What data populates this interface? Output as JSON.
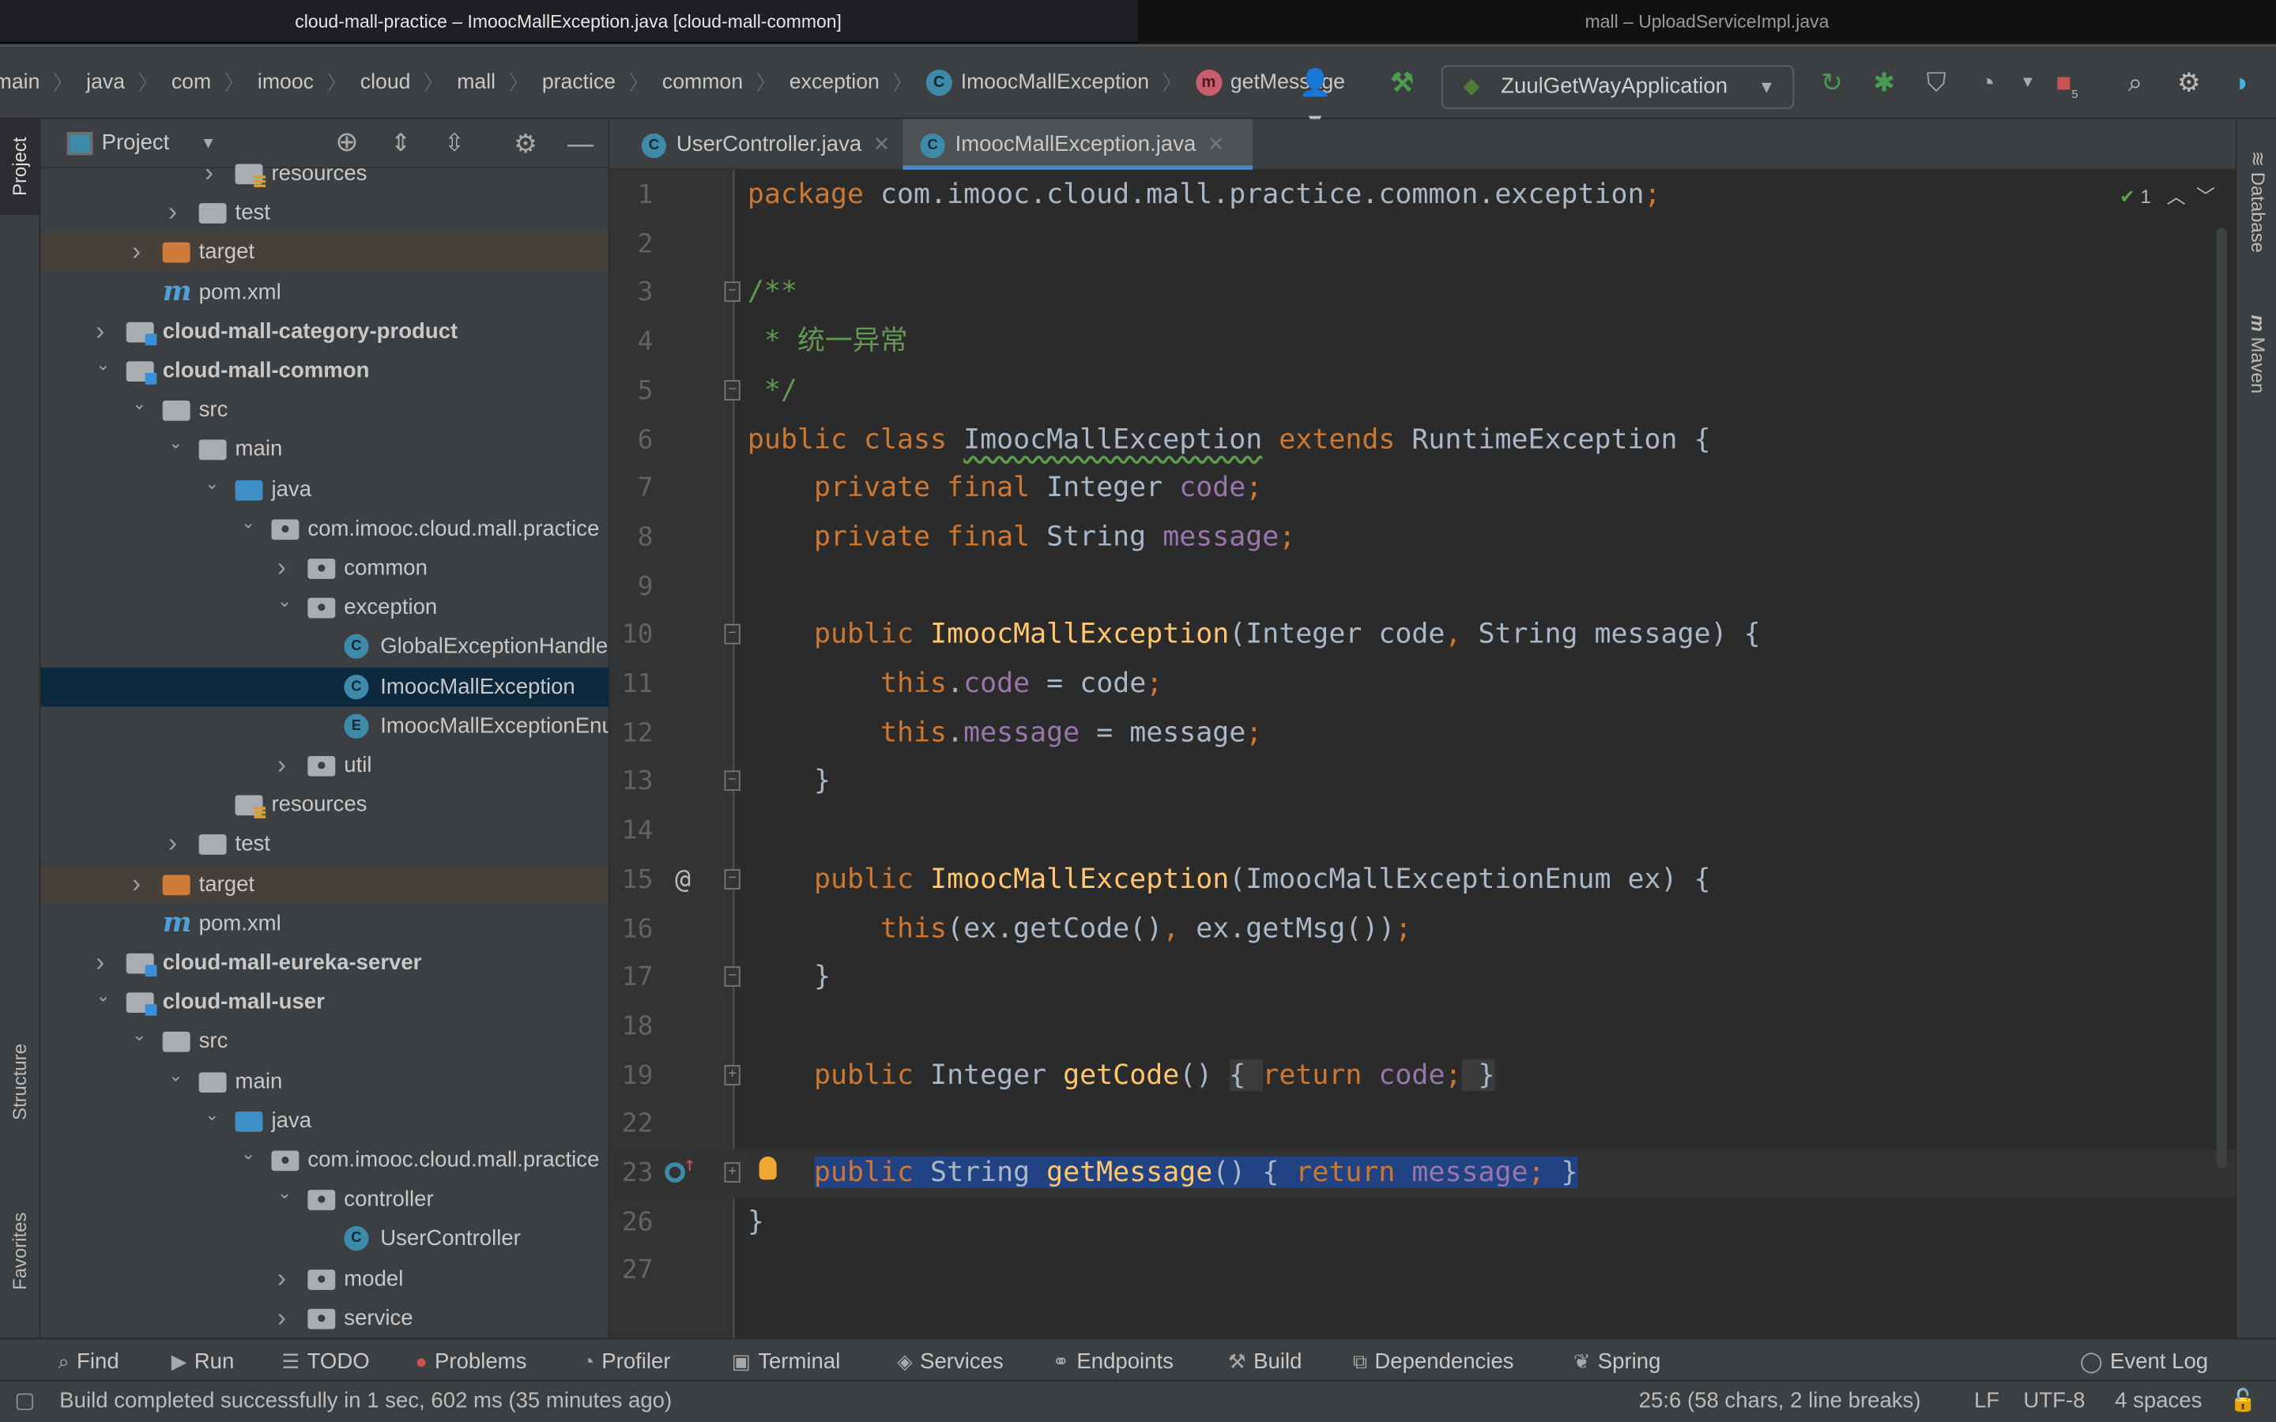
{
  "window": {
    "title": "cloud-mall-practice – ImoocMallException.java [cloud-mall-common]",
    "other_window_title": "mall – UploadServiceImpl.java"
  },
  "breadcrumb": [
    "main",
    "java",
    "com",
    "imooc",
    "cloud",
    "mall",
    "practice",
    "common",
    "exception",
    "ImoocMallException",
    "getMessage"
  ],
  "run_config": {
    "label": "ZuulGetWayApplication"
  },
  "toolbar_icons": [
    "user-icon",
    "hammer-icon",
    "rerun-icon",
    "debug-icon",
    "coverage-icon",
    "profile-icon",
    "stop-icon",
    "search-icon",
    "gear-icon",
    "toolbox-logo-icon"
  ],
  "stop_badge": "5",
  "left_stripe": {
    "project": "Project",
    "structure": "Structure",
    "favorites": "Favorites"
  },
  "right_stripe": {
    "database": "Database",
    "maven": "Maven"
  },
  "project_panel": {
    "title": "Project",
    "tree": [
      {
        "name": "resources",
        "depth": 3,
        "icon": "res",
        "expanded": false
      },
      {
        "name": "test",
        "depth": 2,
        "icon": "folder",
        "expanded": false
      },
      {
        "name": "target",
        "depth": 1,
        "icon": "excl",
        "expanded": false,
        "highlight": true
      },
      {
        "name": "pom.xml",
        "depth": 1,
        "icon": "mvn"
      },
      {
        "name": "cloud-mall-category-product",
        "depth": 0,
        "icon": "module",
        "expanded": false,
        "bold": true
      },
      {
        "name": "cloud-mall-common",
        "depth": 0,
        "icon": "module",
        "expanded": true,
        "bold": true
      },
      {
        "name": "src",
        "depth": 1,
        "icon": "folder",
        "expanded": true
      },
      {
        "name": "main",
        "depth": 2,
        "icon": "folder",
        "expanded": true
      },
      {
        "name": "java",
        "depth": 3,
        "icon": "src",
        "expanded": true
      },
      {
        "name": "com.imooc.cloud.mall.practice",
        "depth": 4,
        "icon": "pkg",
        "expanded": true
      },
      {
        "name": "common",
        "depth": 5,
        "icon": "pkg",
        "expanded": false
      },
      {
        "name": "exception",
        "depth": 5,
        "icon": "pkg",
        "expanded": true
      },
      {
        "name": "GlobalExceptionHandler",
        "depth": 6,
        "icon": "cls"
      },
      {
        "name": "ImoocMallException",
        "depth": 6,
        "icon": "cls",
        "selected": true
      },
      {
        "name": "ImoocMallExceptionEnum",
        "depth": 6,
        "icon": "enm"
      },
      {
        "name": "util",
        "depth": 5,
        "icon": "pkg",
        "expanded": false
      },
      {
        "name": "resources",
        "depth": 3,
        "icon": "res"
      },
      {
        "name": "test",
        "depth": 2,
        "icon": "folder",
        "expanded": false
      },
      {
        "name": "target",
        "depth": 1,
        "icon": "excl",
        "expanded": false,
        "highlight": true
      },
      {
        "name": "pom.xml",
        "depth": 1,
        "icon": "mvn"
      },
      {
        "name": "cloud-mall-eureka-server",
        "depth": 0,
        "icon": "module",
        "expanded": false,
        "bold": true
      },
      {
        "name": "cloud-mall-user",
        "depth": 0,
        "icon": "module",
        "expanded": true,
        "bold": true
      },
      {
        "name": "src",
        "depth": 1,
        "icon": "folder",
        "expanded": true
      },
      {
        "name": "main",
        "depth": 2,
        "icon": "folder",
        "expanded": true
      },
      {
        "name": "java",
        "depth": 3,
        "icon": "src",
        "expanded": true
      },
      {
        "name": "com.imooc.cloud.mall.practice",
        "depth": 4,
        "icon": "pkg",
        "expanded": true
      },
      {
        "name": "controller",
        "depth": 5,
        "icon": "pkg",
        "expanded": true
      },
      {
        "name": "UserController",
        "depth": 6,
        "icon": "cls"
      },
      {
        "name": "model",
        "depth": 5,
        "icon": "pkg",
        "expanded": false
      },
      {
        "name": "service",
        "depth": 5,
        "icon": "pkg",
        "expanded": false
      }
    ]
  },
  "tabs": [
    {
      "label": "UserController.java",
      "active": false
    },
    {
      "label": "ImoocMallException.java",
      "active": true
    }
  ],
  "editor": {
    "inspection_count": "1",
    "lines": [
      {
        "n": "1",
        "t": [
          [
            "package",
            "kw"
          ],
          [
            " com.imooc.cloud.mall.practice.common.exception",
            ""
          ],
          [
            ";",
            "kw"
          ]
        ]
      },
      {
        "n": "2",
        "t": []
      },
      {
        "n": "3",
        "fold": "open",
        "t": [
          [
            "/**",
            "cm"
          ]
        ]
      },
      {
        "n": "4",
        "t": [
          [
            " * 统一异常",
            "cm"
          ]
        ]
      },
      {
        "n": "5",
        "fold": "close",
        "t": [
          [
            " */",
            "cm"
          ]
        ]
      },
      {
        "n": "6",
        "t": [
          [
            "public class ",
            "kw"
          ],
          [
            "ImoocMallException",
            "sq"
          ],
          [
            " ",
            ""
          ],
          [
            "extends ",
            "kw"
          ],
          [
            "RuntimeException {",
            ""
          ]
        ]
      },
      {
        "n": "7",
        "t": [
          [
            "    private final ",
            "kw"
          ],
          [
            "Integer ",
            ""
          ],
          [
            "code",
            "fd"
          ],
          [
            ";",
            "kw"
          ]
        ]
      },
      {
        "n": "8",
        "t": [
          [
            "    private final ",
            "kw"
          ],
          [
            "String ",
            ""
          ],
          [
            "message",
            "fd"
          ],
          [
            ";",
            "kw"
          ]
        ]
      },
      {
        "n": "9",
        "t": []
      },
      {
        "n": "10",
        "fold": "open",
        "t": [
          [
            "    public ",
            "kw"
          ],
          [
            "ImoocMallException",
            "fn"
          ],
          [
            "(Integer code",
            ""
          ],
          [
            ", ",
            "kw"
          ],
          [
            "String message) {",
            ""
          ]
        ]
      },
      {
        "n": "11",
        "t": [
          [
            "        this",
            "kw"
          ],
          [
            ".",
            ""
          ],
          [
            "code",
            "fd"
          ],
          [
            " = code",
            ""
          ],
          [
            ";",
            "kw"
          ]
        ]
      },
      {
        "n": "12",
        "t": [
          [
            "        this",
            "kw"
          ],
          [
            ".",
            ""
          ],
          [
            "message",
            "fd"
          ],
          [
            " = message",
            ""
          ],
          [
            ";",
            "kw"
          ]
        ]
      },
      {
        "n": "13",
        "fold": "close",
        "t": [
          [
            "    }",
            ""
          ]
        ]
      },
      {
        "n": "14",
        "t": []
      },
      {
        "n": "15",
        "fold": "open",
        "at": true,
        "t": [
          [
            "    public ",
            "kw"
          ],
          [
            "ImoocMallException",
            "fn"
          ],
          [
            "(ImoocMallExceptionEnum ex) {",
            ""
          ]
        ]
      },
      {
        "n": "16",
        "t": [
          [
            "        this",
            "kw"
          ],
          [
            "(ex.getCode()",
            ""
          ],
          [
            ", ",
            "kw"
          ],
          [
            "ex.getMsg())",
            ""
          ],
          [
            ";",
            "kw"
          ]
        ]
      },
      {
        "n": "17",
        "fold": "close",
        "t": [
          [
            "    }",
            ""
          ]
        ]
      },
      {
        "n": "18",
        "t": []
      },
      {
        "n": "19",
        "fold": "plus",
        "t": [
          [
            "    public ",
            "kw"
          ],
          [
            "Integer ",
            ""
          ],
          [
            "getCode",
            "fn"
          ],
          [
            "() ",
            ""
          ],
          [
            "{ ",
            "fold"
          ],
          [
            "return ",
            "kw"
          ],
          [
            "code",
            "fd"
          ],
          [
            ";",
            "kw"
          ],
          [
            " }",
            "fold"
          ]
        ]
      },
      {
        "n": "22",
        "t": []
      },
      {
        "n": "23",
        "fold": "plus",
        "current": true,
        "override": true,
        "bulb": true,
        "t": [
          [
            "    ",
            ""
          ],
          [
            "public ",
            "kw sel"
          ],
          [
            "String ",
            "sel"
          ],
          [
            "getMessage",
            "fn sel"
          ],
          [
            "() ",
            "sel"
          ],
          [
            "{ ",
            "sel"
          ],
          [
            "return ",
            "kw sel"
          ],
          [
            "message",
            "fd sel"
          ],
          [
            "; ",
            "kw sel"
          ],
          [
            "}",
            "sel"
          ]
        ]
      },
      {
        "n": "26",
        "t": [
          [
            "}",
            ""
          ]
        ]
      },
      {
        "n": "27",
        "t": []
      }
    ]
  },
  "tool_windows": [
    {
      "label": "Find",
      "icon": "search-icon"
    },
    {
      "label": "Run",
      "icon": "play-icon"
    },
    {
      "label": "TODO",
      "icon": "list-icon"
    },
    {
      "label": "Problems",
      "icon": "error-icon"
    },
    {
      "label": "Profiler",
      "icon": "profiler-icon"
    },
    {
      "label": "Terminal",
      "icon": "terminal-icon"
    },
    {
      "label": "Services",
      "icon": "services-icon"
    },
    {
      "label": "Endpoints",
      "icon": "endpoints-icon"
    },
    {
      "label": "Build",
      "icon": "hammer-icon"
    },
    {
      "label": "Dependencies",
      "icon": "dependencies-icon"
    },
    {
      "label": "Spring",
      "icon": "spring-icon"
    }
  ],
  "event_log": "Event Log",
  "status": {
    "message": "Build completed successfully in 1 sec, 602 ms (35 minutes ago)",
    "position": "25:6 (58 chars, 2 line breaks)",
    "line_sep": "LF",
    "encoding": "UTF-8",
    "indent": "4 spaces"
  },
  "colors": {
    "keyword": "#cc7832",
    "field": "#9876aa",
    "method": "#ffc66d",
    "comment": "#629755",
    "selection": "#214283",
    "accent": "#4a88c7"
  }
}
